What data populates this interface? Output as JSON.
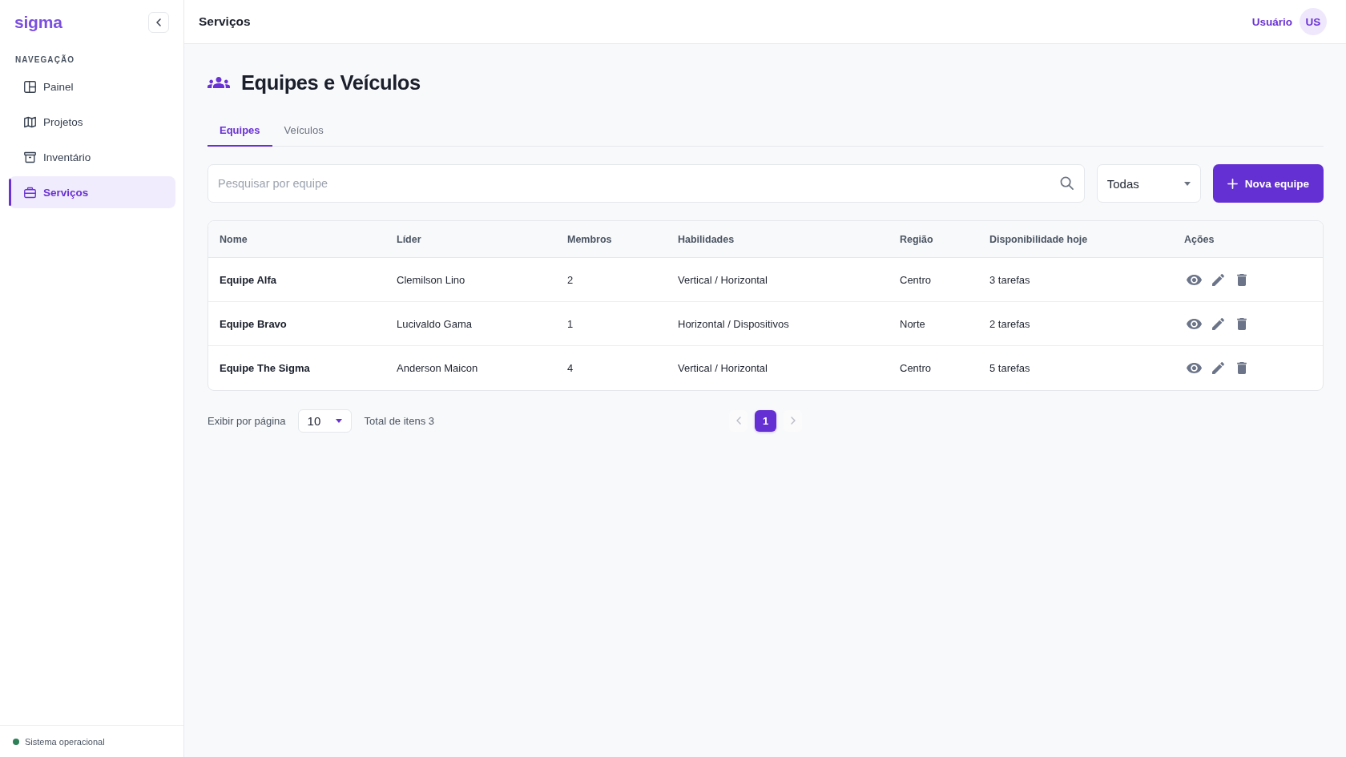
{
  "sidebar": {
    "logo": "sigma",
    "section_label": "NAVEGAÇÃO",
    "items": [
      {
        "label": "Painel",
        "selected": false
      },
      {
        "label": "Projetos",
        "selected": false
      },
      {
        "label": "Inventário",
        "selected": false
      },
      {
        "label": "Serviços",
        "selected": true
      }
    ],
    "status": "Sistema operacional"
  },
  "header": {
    "title": "Serviços",
    "user_name": "Usuário",
    "avatar_initials": "US"
  },
  "page": {
    "title": "Equipes e Veículos"
  },
  "tabs": [
    {
      "label": "Equipes",
      "selected": true
    },
    {
      "label": "Veículos",
      "selected": false
    }
  ],
  "search": {
    "placeholder": "Pesquisar por equipe"
  },
  "filter": {
    "value": "Todas"
  },
  "new_button": {
    "label": "Nova equipe"
  },
  "table": {
    "columns": [
      "Nome",
      "Líder",
      "Membros",
      "Habilidades",
      "Região",
      "Disponibilidade hoje",
      "Ações"
    ],
    "rows": [
      {
        "cells": [
          "Equipe Alfa",
          "Clemilson Lino",
          "2",
          "Vertical / Horizontal",
          "Centro",
          "3 tarefas"
        ]
      },
      {
        "cells": [
          "Equipe Bravo",
          "Lucivaldo Gama",
          "1",
          "Horizontal / Dispositivos",
          "Norte",
          "2 tarefas"
        ]
      },
      {
        "cells": [
          "Equipe The Sigma",
          "Anderson Maicon",
          "4",
          "Vertical / Horizontal",
          "Centro",
          "5 tarefas"
        ]
      }
    ]
  },
  "pagination": {
    "per_page_label": "Exibir por página",
    "per_page": "10",
    "total": "Total de itens 3",
    "previous": {
      "disabled": true
    },
    "pages": [
      {
        "label": "1",
        "selected": true
      }
    ],
    "next": {
      "disabled": true
    }
  }
}
